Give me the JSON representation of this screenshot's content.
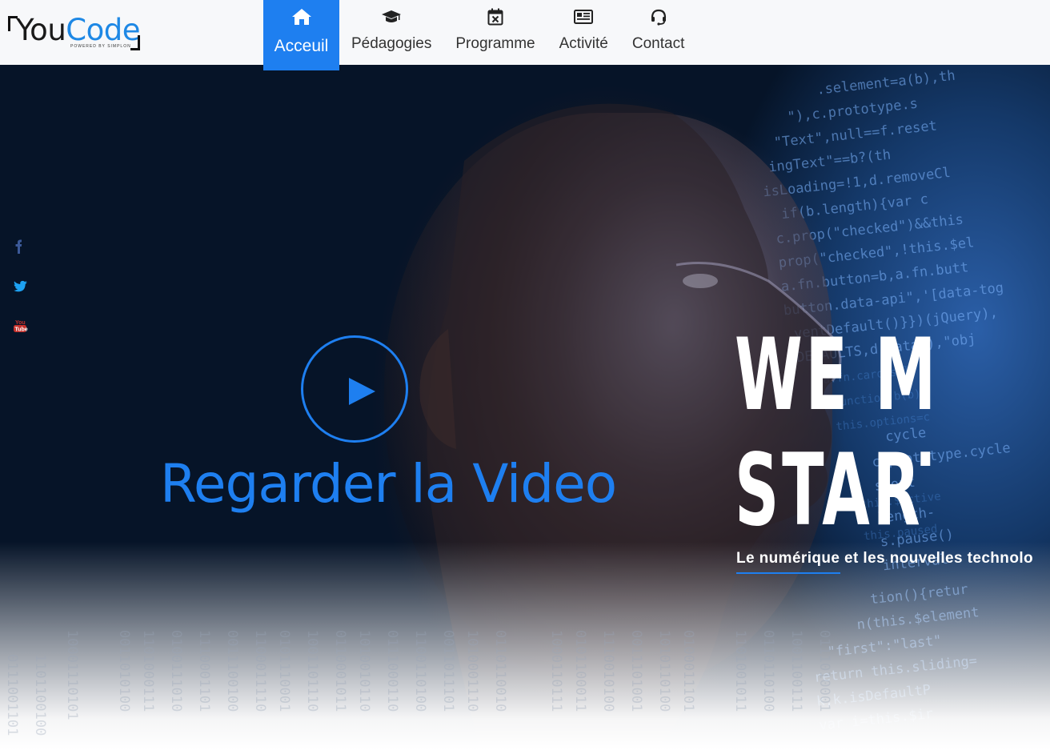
{
  "brand": {
    "logo_you": "You",
    "logo_code": "Code",
    "logo_tagline": "POWERED BY SIMPLON"
  },
  "nav": {
    "items": [
      {
        "label": "Acceuil",
        "icon": "home-icon",
        "active": true
      },
      {
        "label": "Pédagogies",
        "icon": "graduation-cap-icon",
        "active": false
      },
      {
        "label": "Programme",
        "icon": "calendar-x-icon",
        "active": false
      },
      {
        "label": "Activité",
        "icon": "newspaper-icon",
        "active": false
      },
      {
        "label": "Contact",
        "icon": "headset-icon",
        "active": false
      }
    ]
  },
  "social": [
    {
      "name": "facebook-icon",
      "color": "#3b5998"
    },
    {
      "name": "twitter-icon",
      "color": "#1da1f2"
    },
    {
      "name": "youtube-icon",
      "color": "#c4302b"
    }
  ],
  "hero": {
    "video_label": "Regarder la Video",
    "headline_line1": "WE MAKE",
    "headline_line2": "STARTUP",
    "tagline": "Le numérique et les nouvelles technolo"
  },
  "colors": {
    "accent": "#1e7ff0",
    "nav_bg": "#f7f8fa",
    "text_dark": "#333333"
  }
}
